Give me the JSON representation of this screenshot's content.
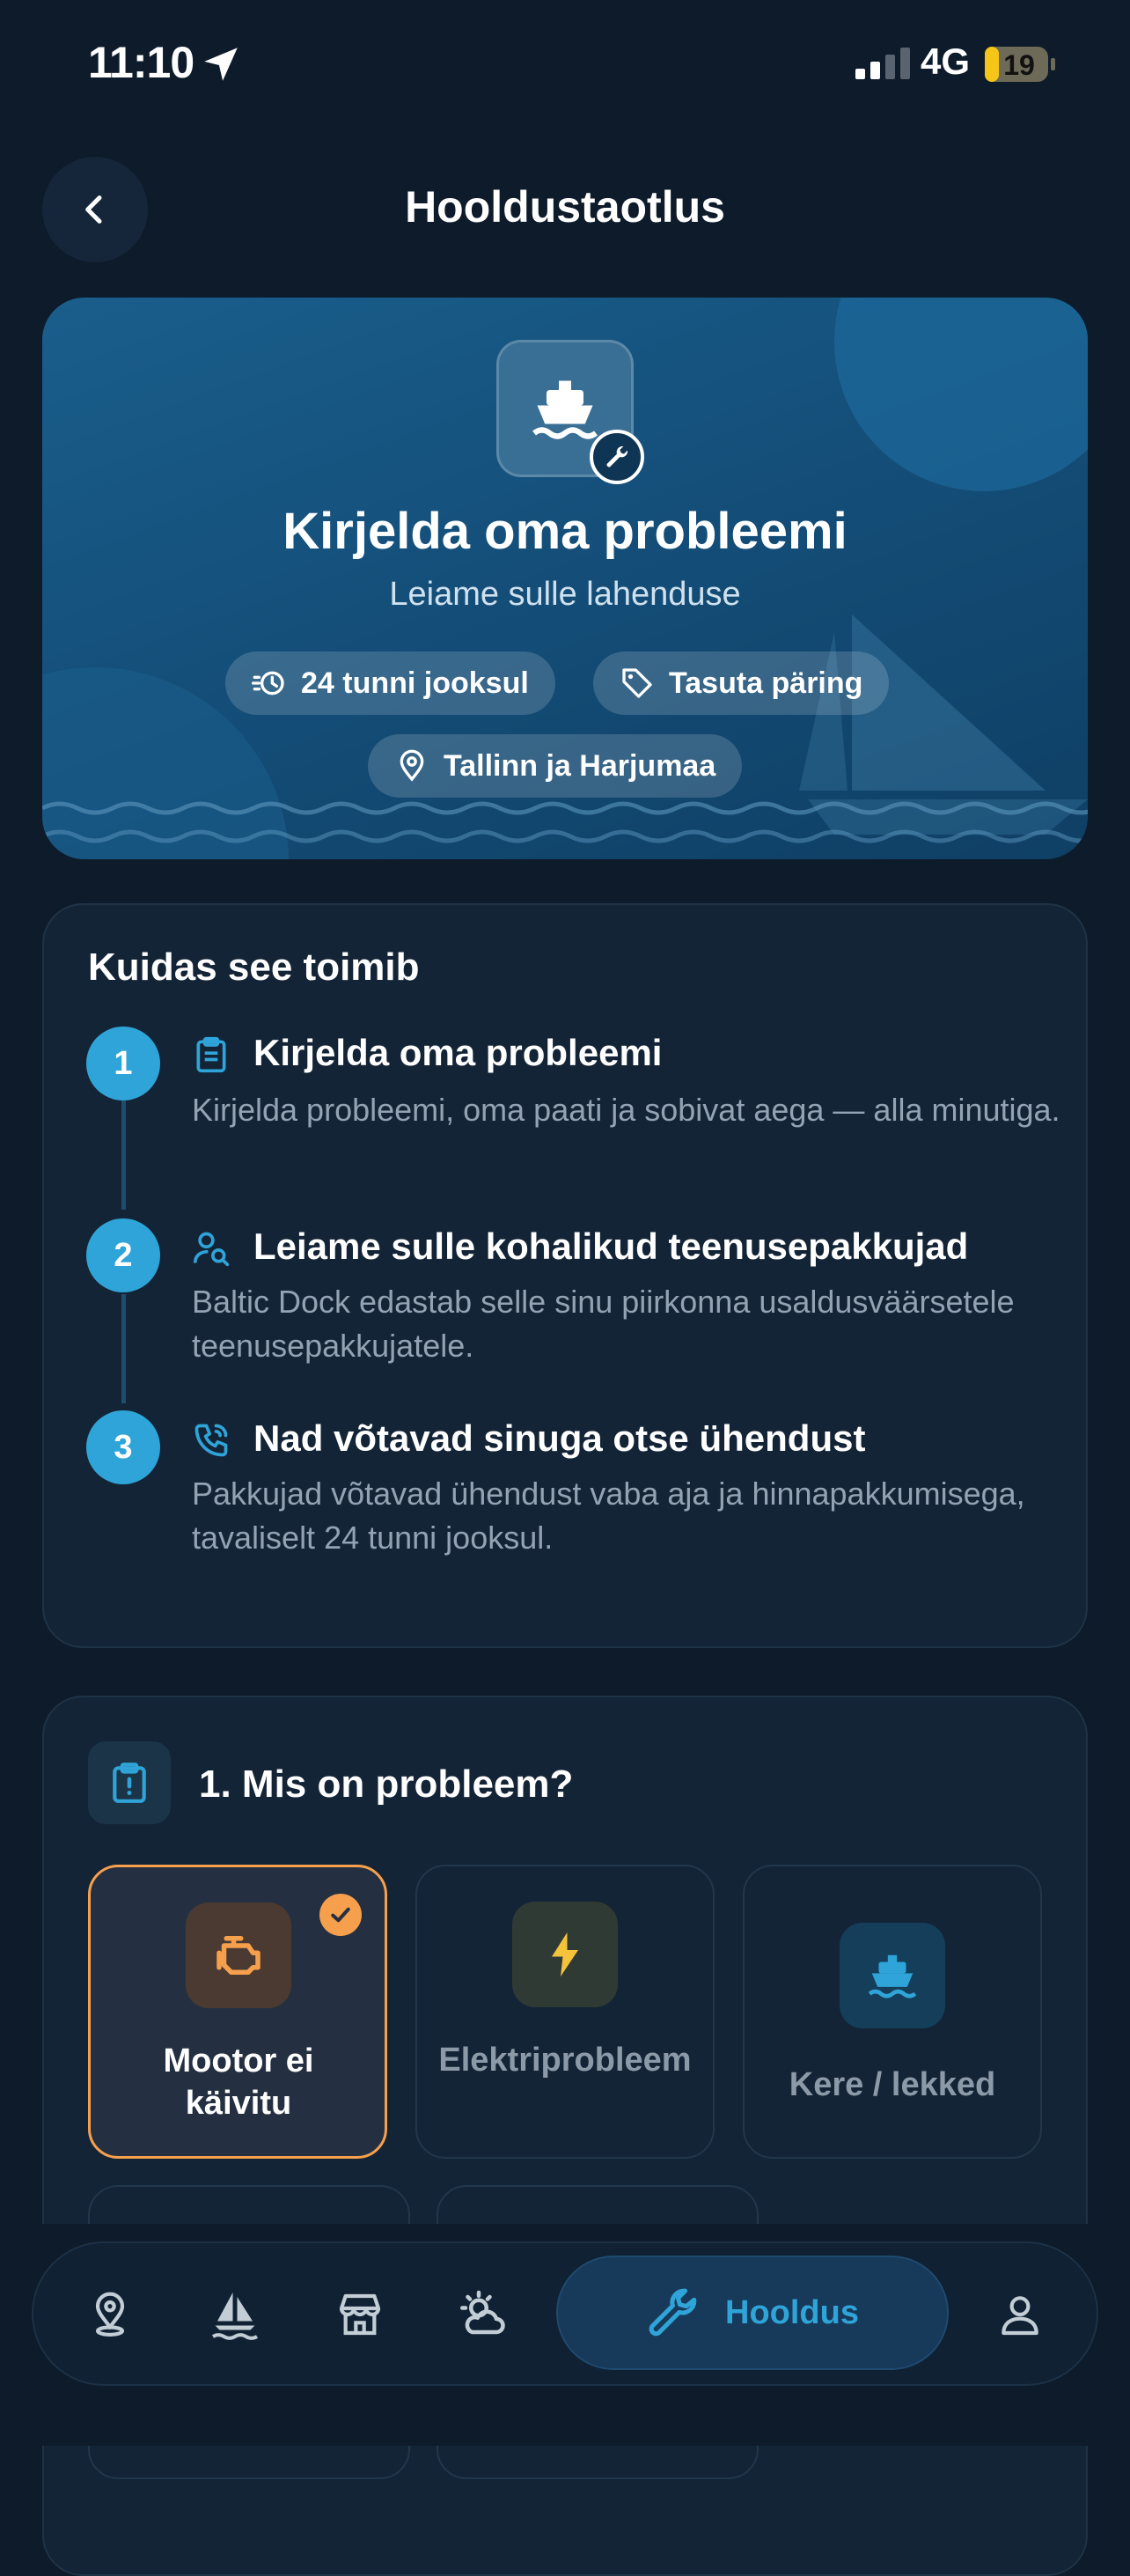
{
  "status": {
    "time": "11:10",
    "network": "4G",
    "battery": "19"
  },
  "header": {
    "title": "Hooldustaotlus"
  },
  "hero": {
    "title": "Kirjelda oma probleemi",
    "subtitle": "Leiame sulle lahenduse",
    "chips": [
      {
        "label": "24 tunni jooksul",
        "icon": "clock-icon"
      },
      {
        "label": "Tasuta päring",
        "icon": "tag-icon"
      },
      {
        "label": "Tallinn ja Harjumaa",
        "icon": "location-pin-icon"
      }
    ]
  },
  "how_it_works": {
    "title": "Kuidas see toimib",
    "steps": [
      {
        "number": "1",
        "icon": "clipboard-icon",
        "title": "Kirjelda oma probleemi",
        "text": "Kirjelda probleemi, oma paati ja sobivat aega — alla minutiga."
      },
      {
        "number": "2",
        "icon": "person-search-icon",
        "title": "Leiame sulle kohalikud teenusepakkujad",
        "text": "Baltic Dock edastab selle sinu piirkonna usaldusväärsetele teenusepakkujatele."
      },
      {
        "number": "3",
        "icon": "phone-call-icon",
        "title": "Nad võtavad sinuga otse ühendust",
        "text": "Pakkujad võtavad ühendust vaba aja ja hinnapakkumisega, tavaliselt 24 tunni jooksul."
      }
    ]
  },
  "problem": {
    "title": "1. Mis on probleem?",
    "options": [
      {
        "label": "Mootor ei käivitu",
        "icon": "engine-icon",
        "selected": true
      },
      {
        "label": "Elektriprobleem",
        "icon": "lightning-icon",
        "selected": false
      },
      {
        "label": "Kere / lekked",
        "icon": "boat-icon",
        "selected": false
      }
    ]
  },
  "nav": {
    "items": [
      "map-pin-icon",
      "sailboat-icon",
      "store-icon",
      "weather-icon",
      "wrench-icon",
      "profile-icon"
    ],
    "active_label": "Hooldus"
  },
  "colors": {
    "accent": "#2fa4d8",
    "selected": "#f6a04d",
    "background": "#0d1b2a"
  }
}
